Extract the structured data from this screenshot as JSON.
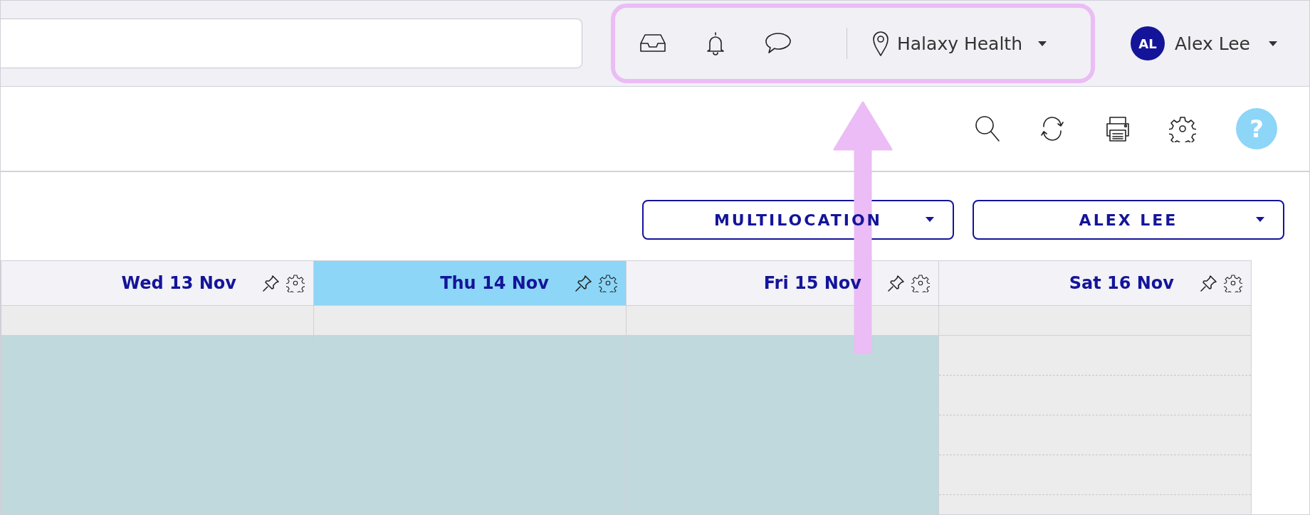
{
  "top_bar": {
    "icons": [
      {
        "kind": "inbox"
      },
      {
        "kind": "bell"
      },
      {
        "kind": "chat"
      }
    ],
    "location": {
      "label": "Halaxy Health"
    },
    "user": {
      "initials": "AL",
      "name": "Alex Lee"
    }
  },
  "toolbar": {
    "icons": [
      {
        "kind": "search"
      },
      {
        "kind": "refresh"
      },
      {
        "kind": "print"
      },
      {
        "kind": "settings"
      },
      {
        "kind": "help",
        "label": "?"
      }
    ]
  },
  "filters": [
    {
      "label": "MULTILOCATION"
    },
    {
      "label": "ALEX LEE"
    }
  ],
  "calendar": {
    "days": [
      {
        "label": "Wed 13 Nov",
        "selected": false,
        "available": true
      },
      {
        "label": "Thu 14 Nov",
        "selected": true,
        "available": true
      },
      {
        "label": "Fri 15 Nov",
        "selected": false,
        "available": true
      },
      {
        "label": "Sat 16 Nov",
        "selected": false,
        "available": false
      }
    ]
  },
  "annotation": {
    "highlight": true,
    "arrow": true
  }
}
